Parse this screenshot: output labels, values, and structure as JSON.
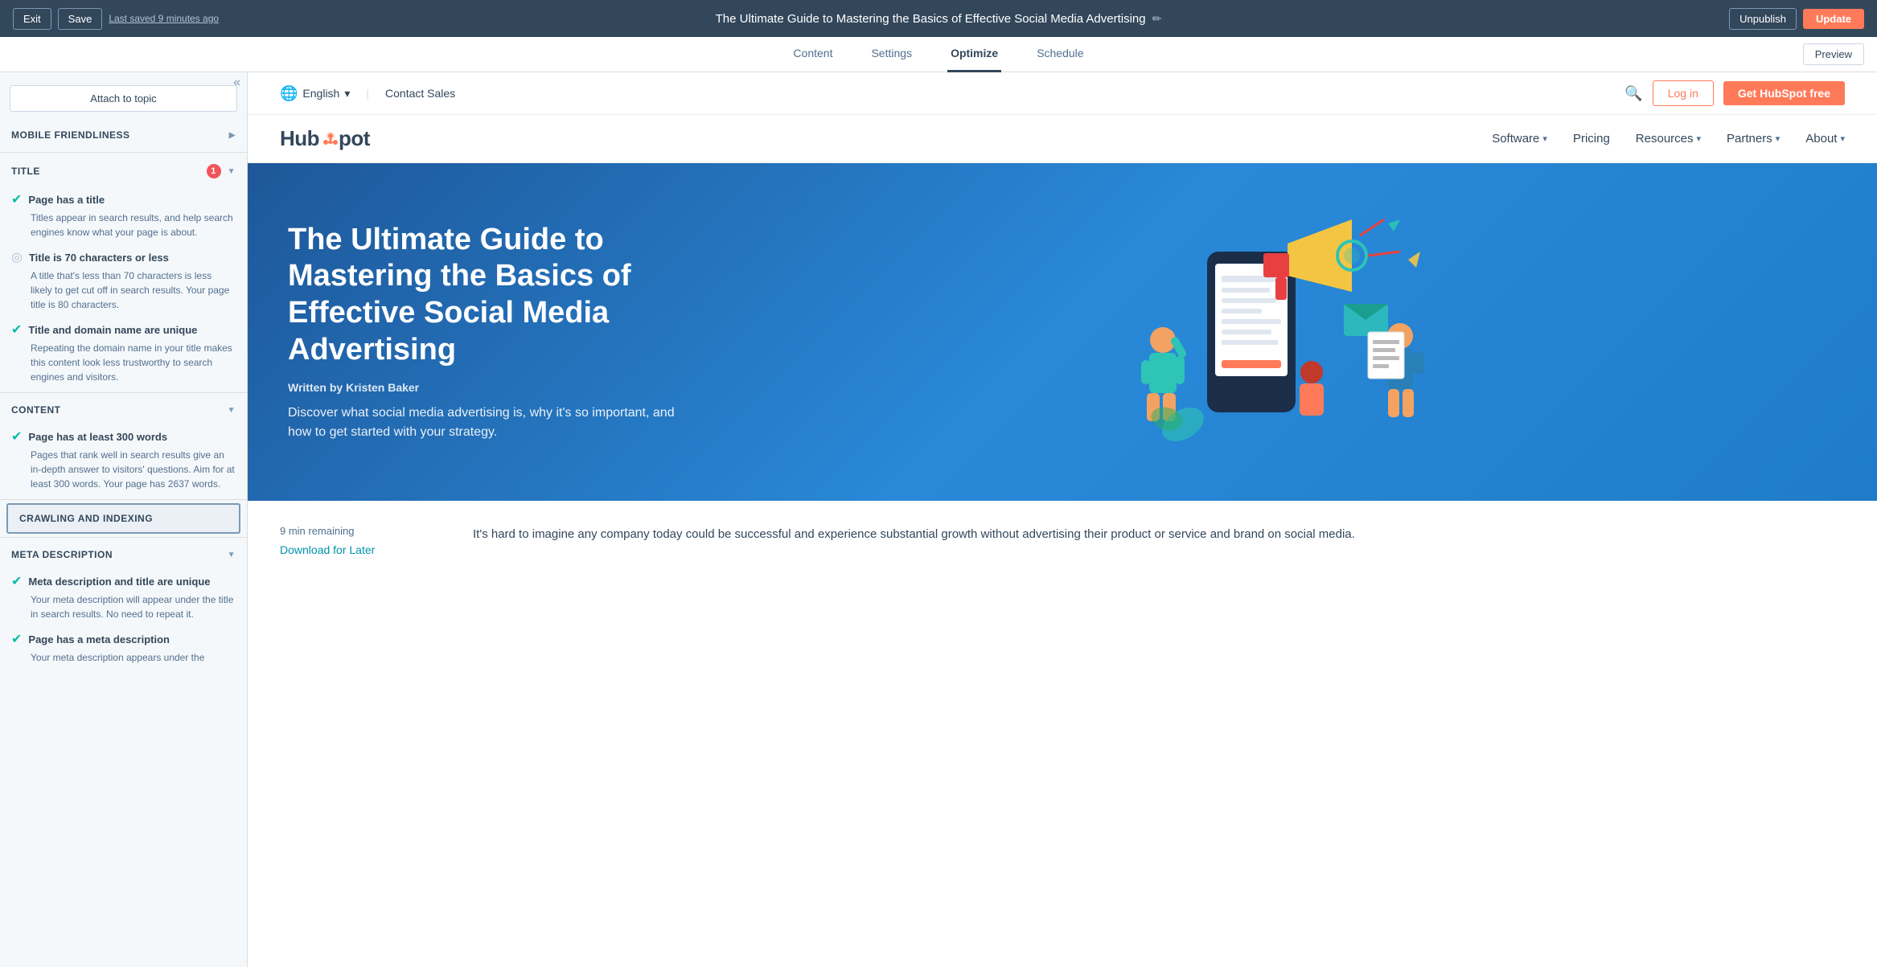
{
  "topbar": {
    "exit_label": "Exit",
    "save_label": "Save",
    "last_saved": "Last saved 9 minutes ago",
    "page_title": "The Ultimate Guide to Mastering the Basics of Effective Social Media Advertising",
    "unpublish_label": "Unpublish",
    "update_label": "Update",
    "preview_label": "Preview"
  },
  "nav_tabs": {
    "tabs": [
      {
        "id": "content",
        "label": "Content",
        "active": false
      },
      {
        "id": "settings",
        "label": "Settings",
        "active": false
      },
      {
        "id": "optimize",
        "label": "Optimize",
        "active": true
      },
      {
        "id": "schedule",
        "label": "Schedule",
        "active": false
      }
    ]
  },
  "sidebar": {
    "collapse_icon": "«",
    "attach_topic_label": "Attach to topic",
    "sections": [
      {
        "id": "mobile_friendliness",
        "label": "Mobile Friendliness",
        "collapsed": true,
        "badge": null
      },
      {
        "id": "title",
        "label": "Title",
        "collapsed": false,
        "badge": "1",
        "items": [
          {
            "status": "green",
            "title": "Page has a title",
            "desc": "Titles appear in search results, and help search engines know what your page is about."
          },
          {
            "status": "gray",
            "title": "Title is 70 characters or less",
            "desc": "A title that's less than 70 characters is less likely to get cut off in search results. Your page title is 80 characters."
          },
          {
            "status": "green",
            "title": "Title and domain name are unique",
            "desc": "Repeating the domain name in your title makes this content look less trustworthy to search engines and visitors."
          }
        ]
      },
      {
        "id": "content",
        "label": "Content",
        "collapsed": false,
        "badge": null,
        "items": [
          {
            "status": "green",
            "title": "Page has at least 300 words",
            "desc": "Pages that rank well in search results give an in-depth answer to visitors' questions. Aim for at least 300 words. Your page has 2637 words."
          }
        ]
      },
      {
        "id": "crawling_indexing",
        "label": "Crawling and Indexing",
        "collapsed": true,
        "badge": null,
        "highlighted": true
      },
      {
        "id": "meta_description",
        "label": "Meta Description",
        "collapsed": false,
        "badge": null,
        "items": [
          {
            "status": "green",
            "title": "Meta description and title are unique",
            "desc": "Your meta description will appear under the title in search results. No need to repeat it."
          },
          {
            "status": "green",
            "title": "Page has a meta description",
            "desc": "Your meta description appears under the"
          }
        ]
      }
    ]
  },
  "hs_page": {
    "topbar": {
      "lang_icon": "🌐",
      "lang_label": "English",
      "lang_arrow": "▾",
      "contact_sales": "Contact Sales",
      "login_label": "Log in",
      "get_free_label": "Get HubSpot free"
    },
    "nav": {
      "logo_text": "HubSpot",
      "nav_items": [
        {
          "label": "Software",
          "has_arrow": true
        },
        {
          "label": "Pricing",
          "has_arrow": false
        },
        {
          "label": "Resources",
          "has_arrow": true
        },
        {
          "label": "Partners",
          "has_arrow": true
        },
        {
          "label": "About",
          "has_arrow": true
        }
      ]
    },
    "hero": {
      "title": "The Ultimate Guide to Mastering the Basics of Effective Social Media Advertising",
      "written_by": "Written by",
      "author": "Kristen Baker",
      "description": "Discover what social media advertising is, why it's so important, and how to get started with your strategy."
    },
    "content": {
      "time_remaining": "9 min remaining",
      "download_label": "Download for Later",
      "body_text": "It's hard to imagine any company today could be successful and experience substantial growth without advertising their product or service and brand on social media."
    }
  }
}
